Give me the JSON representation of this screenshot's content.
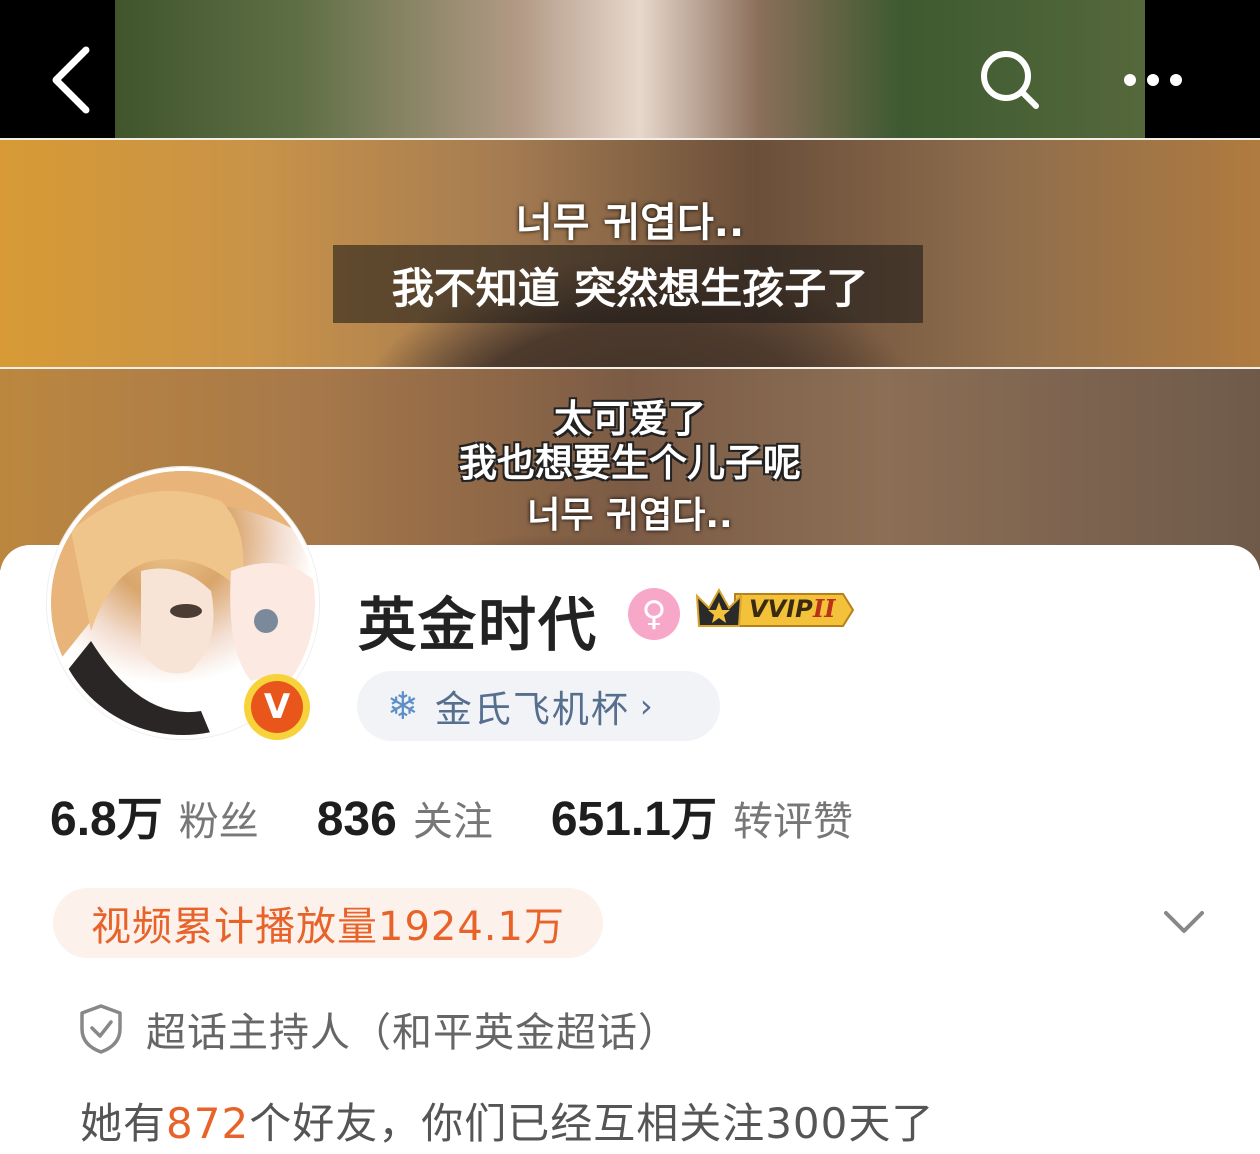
{
  "cover": {
    "subtitle_korean_1": "너무 귀엽다..",
    "subtitle_chinese_1": "我不知道 突然想生孩子了",
    "subtitle_chinese_2": "太可爱了",
    "subtitle_chinese_3": "我也想要生个儿子呢",
    "subtitle_korean_2": "너무 귀엽다.."
  },
  "nav": {
    "back_icon": "chevron-left-icon",
    "search_icon": "search-icon",
    "more_icon": "more-dots-icon"
  },
  "profile": {
    "name": "英金时代",
    "gender_symbol": "♀",
    "vvip_label": "VVIP",
    "vvip_level": "II",
    "verified_badge": "V",
    "super_topic": "金氏飞机杯",
    "super_topic_chevron": "›"
  },
  "stats": [
    {
      "num": "6.8",
      "unit": "万",
      "label": "粉丝"
    },
    {
      "num": "836",
      "unit": "",
      "label": "关注"
    },
    {
      "num": "651.1",
      "unit": "万",
      "label": "转评赞"
    }
  ],
  "video_plays": "视频累计播放量1924.1万",
  "host_role": "超话主持人（和平英金超话）",
  "friends": {
    "prefix": "她有",
    "count": "872",
    "suffix": "个好友，你们已经互相关注300天了"
  },
  "colors": {
    "accent_orange": "#e8632a",
    "supertopic_text": "#566f8f",
    "gender_pink": "#f7a8c9",
    "verified_orange": "#e8561c",
    "verified_gold": "#f7d23a"
  }
}
